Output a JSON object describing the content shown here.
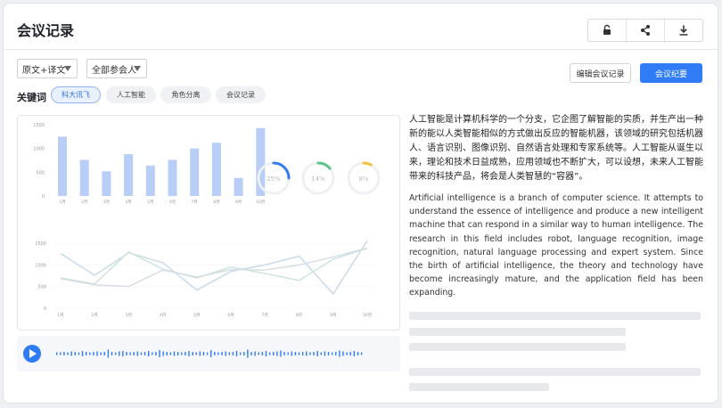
{
  "header": {
    "title": "会议记录"
  },
  "toolbar": {
    "icons": [
      "unlock-icon",
      "share-icon",
      "download-icon"
    ]
  },
  "filters": {
    "language_select": "原文+译文",
    "participant_select": "全部参会人"
  },
  "actions": {
    "edit_label": "编辑会议记录",
    "summary_label": "会议纪要"
  },
  "keywords": {
    "label": "关键词",
    "chips": [
      "科大讯飞",
      "人工智能",
      "角色分离",
      "会议记录"
    ],
    "active_index": 0
  },
  "chart_data": [
    {
      "type": "bar",
      "categories": [
        "1月",
        "2月",
        "3月",
        "4月",
        "5月",
        "6月",
        "7月",
        "8月",
        "9月",
        "10月"
      ],
      "values": [
        1250,
        760,
        520,
        880,
        640,
        760,
        1000,
        1120,
        380,
        1430
      ],
      "ytick_labels": [
        "0",
        "500",
        "1000",
        "1500"
      ],
      "ylim": [
        0,
        1500
      ],
      "color": "#b9cef7"
    },
    {
      "type": "gauge",
      "values": [
        25,
        14,
        8
      ],
      "labels": [
        "25%",
        "14%",
        "8%"
      ],
      "colors": [
        "#2f7cf6",
        "#5cc38a",
        "#f2c23a"
      ]
    },
    {
      "type": "line",
      "x": [
        "1月",
        "2月",
        "3月",
        "4月",
        "5月",
        "6月",
        "7月",
        "8月",
        "9月",
        "10月"
      ],
      "ytick_labels": [
        "0",
        "500",
        "1000",
        "1500"
      ],
      "ylim": [
        0,
        1500
      ],
      "series": [
        {
          "values": [
            1260,
            760,
            1280,
            1050,
            420,
            850,
            1000,
            1200,
            330,
            1560
          ],
          "color": "#c9dbe9"
        },
        {
          "values": [
            700,
            560,
            1300,
            900,
            700,
            950,
            800,
            640,
            1130,
            1380
          ],
          "color": "#cde4dc"
        },
        {
          "values": [
            680,
            540,
            500,
            880,
            720,
            890,
            880,
            1000,
            1180,
            1390
          ],
          "color": "#d6dde6"
        }
      ]
    }
  ],
  "audio": {
    "bars": [
      3,
      3,
      4,
      3,
      5,
      4,
      3,
      6,
      4,
      3,
      4,
      5,
      3,
      4,
      9,
      4,
      3,
      5,
      6,
      4,
      3,
      4,
      5,
      3,
      4,
      6,
      3,
      4,
      8,
      5,
      4,
      3,
      5,
      4,
      3,
      4,
      6,
      4,
      3,
      5,
      4,
      3,
      8,
      4,
      3,
      4,
      5,
      3,
      4,
      6,
      3,
      4,
      9,
      4,
      5,
      3,
      4,
      6,
      3,
      4,
      5,
      7,
      4,
      3,
      5,
      4,
      3,
      4,
      5,
      3,
      4,
      6,
      3,
      5,
      4,
      3,
      4,
      7,
      5,
      3,
      4,
      6,
      4,
      3
    ],
    "accent": "#2f7cf6"
  },
  "transcript": {
    "cn": "人工智能是计算机科学的一个分支，它企图了解智能的实质，并生产出一种新的能以人类智能相似的方式做出反应的智能机器，该领域的研究包括机器人、语言识别、图像识别、自然语言处理和专家系统等。人工智能从诞生以来，理论和技术日益成熟，应用领域也不断扩大，可以设想，未来人工智能带来的科技产品，将会是人类智慧的“容器”。",
    "en": "Artificial intelligence is a branch of computer science. It attempts to understand the essence of intelligence and produce a new intelligent machine that can respond in a similar way to human intelligence. The research in this field includes robot, language recognition, image recognition, natural language processing and expert system. Since the birth of artificial intelligence, the theory and technology have become increasingly mature, and the application field has been expanding."
  },
  "colors": {
    "accent": "#2f7cf6",
    "border": "#e3e5e8",
    "placeholder": "#e7e9ec"
  }
}
